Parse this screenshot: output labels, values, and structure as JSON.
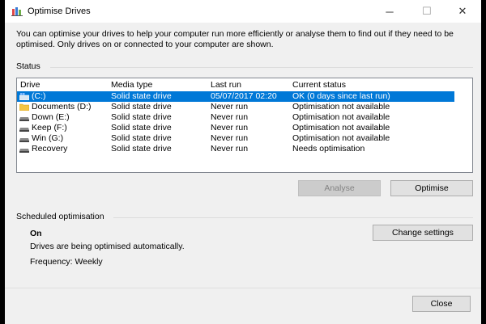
{
  "window": {
    "title": "Optimise Drives",
    "controls": {
      "minimize": "─",
      "maximize": "☐",
      "close": "✕"
    }
  },
  "description": "You can optimise your drives to help your computer run more efficiently or analyse them to find out if they need to be optimised. Only drives on or connected to your computer are shown.",
  "status": {
    "label": "Status",
    "columns": [
      "Drive",
      "Media type",
      "Last run",
      "Current status"
    ],
    "drives": [
      {
        "icon": "windows-drive-icon",
        "name": "(C:)",
        "media": "Solid state drive",
        "last_run": "05/07/2017 02:20",
        "status": "OK (0 days since last run)",
        "selected": true
      },
      {
        "icon": "folder-drive-icon",
        "name": "Documents (D:)",
        "media": "Solid state drive",
        "last_run": "Never run",
        "status": "Optimisation not available",
        "selected": false
      },
      {
        "icon": "hard-drive-icon",
        "name": "Down (E:)",
        "media": "Solid state drive",
        "last_run": "Never run",
        "status": "Optimisation not available",
        "selected": false
      },
      {
        "icon": "hard-drive-icon",
        "name": "Keep (F:)",
        "media": "Solid state drive",
        "last_run": "Never run",
        "status": "Optimisation not available",
        "selected": false
      },
      {
        "icon": "hard-drive-icon",
        "name": "Win (G:)",
        "media": "Solid state drive",
        "last_run": "Never run",
        "status": "Optimisation not available",
        "selected": false
      },
      {
        "icon": "hard-drive-icon",
        "name": "Recovery",
        "media": "Solid state drive",
        "last_run": "Never run",
        "status": "Needs optimisation",
        "selected": false
      }
    ],
    "analyse_label": "Analyse",
    "optimise_label": "Optimise"
  },
  "scheduled": {
    "label": "Scheduled optimisation",
    "state": "On",
    "info": "Drives are being optimised automatically.",
    "frequency": "Frequency: Weekly",
    "change_label": "Change settings"
  },
  "footer": {
    "close_label": "Close"
  },
  "colors": {
    "selection": "#0078d7",
    "window_bg": "#f0f0f0"
  }
}
